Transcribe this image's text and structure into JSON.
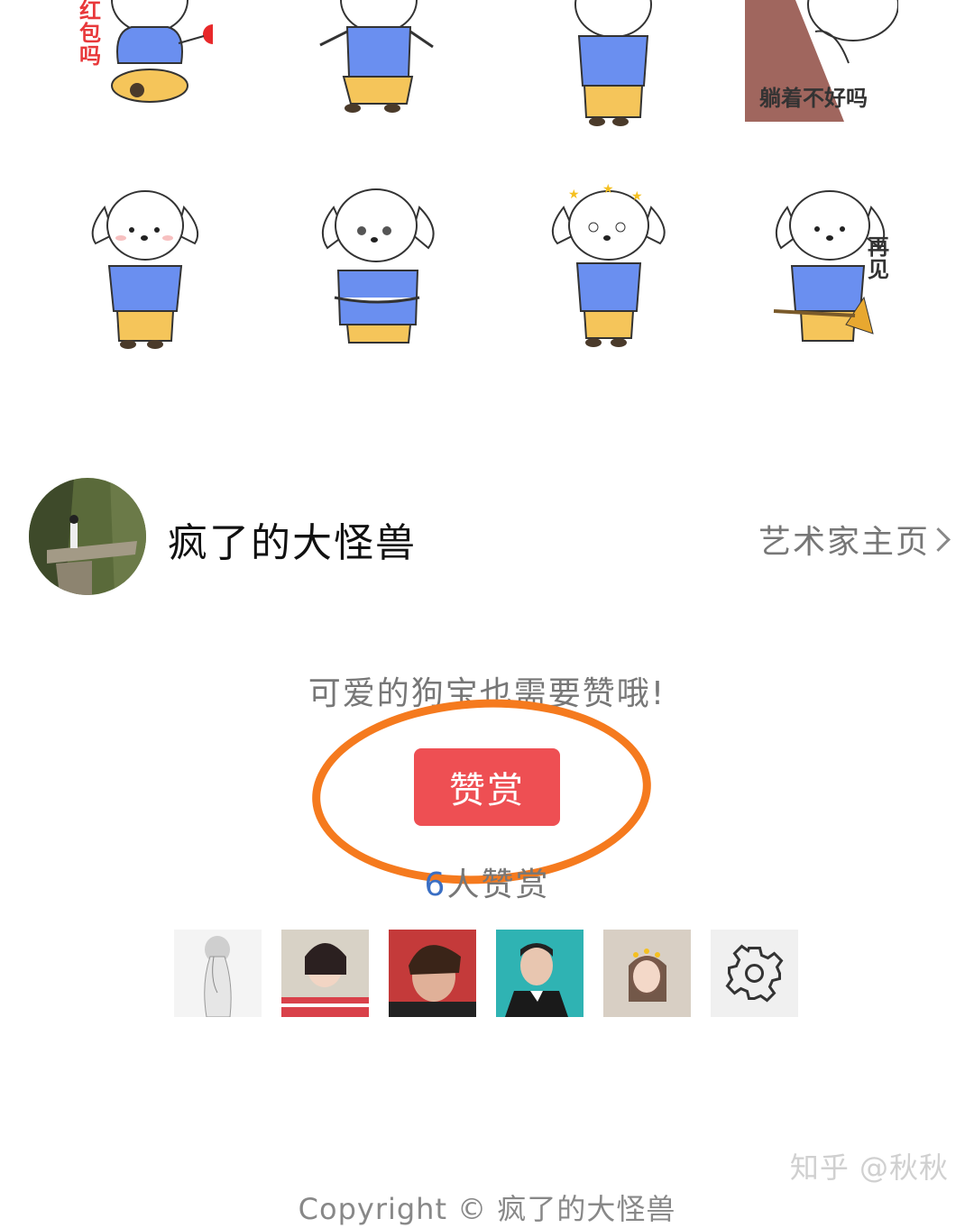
{
  "stickers": [
    {
      "caption": "红包吗",
      "pose": "sitting-with-red-envelope"
    },
    {
      "caption": "",
      "pose": "arms-out"
    },
    {
      "caption": "",
      "pose": "standing"
    },
    {
      "caption": "躺着不好吗",
      "pose": "lying-peek"
    },
    {
      "caption": "",
      "pose": "standing-pout"
    },
    {
      "caption": "",
      "pose": "worried-hands"
    },
    {
      "caption": "",
      "pose": "dizzy-stars"
    },
    {
      "caption": "再见",
      "pose": "waving-broom"
    }
  ],
  "artist": {
    "name": "疯了的大怪兽",
    "homepage_link": "艺术家主页"
  },
  "reward": {
    "prompt": "可爱的狗宝也需要赞哦!",
    "button_label": "赞赏",
    "count": "6",
    "count_suffix": "人赞赏"
  },
  "supporters": [
    {
      "name": "sketch-girl-avatar"
    },
    {
      "name": "woman-avatar"
    },
    {
      "name": "anime-boy-avatar"
    },
    {
      "name": "man-tuxedo-avatar"
    },
    {
      "name": "girl-crown-avatar"
    }
  ],
  "footer": {
    "watermark": "知乎 @秋秋",
    "copyright": "Copyright © 疯了的大怪兽"
  },
  "colors": {
    "accent_button": "#ee4f53",
    "highlight_ring": "#f57a1e",
    "count_number": "#3a6fc4",
    "dog_shirt": "#6a8ff0",
    "dog_pants": "#f5c55a"
  }
}
